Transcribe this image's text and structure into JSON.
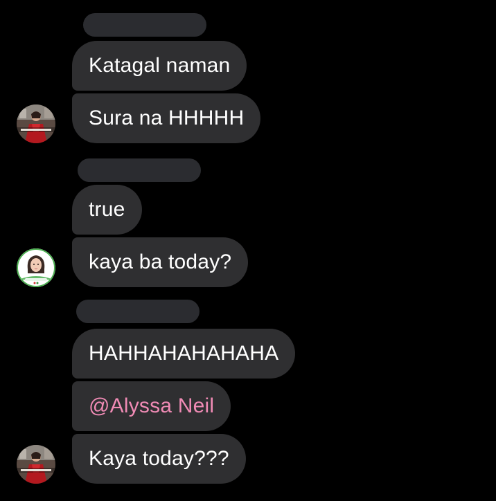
{
  "groups": [
    {
      "messages": [
        "Katagal naman",
        "Sura na HHHHH"
      ],
      "avatar_name": "user-avatar-red-dress"
    },
    {
      "messages": [
        "true",
        "kaya ba today?"
      ],
      "avatar_name": "user-avatar-girl-green-frame"
    },
    {
      "messages": [
        "HAHHAHAHAHAHA",
        "@Alyssa Neil",
        "Kaya today???"
      ],
      "avatar_name": "user-avatar-red-dress"
    }
  ],
  "colors": {
    "background": "#000000",
    "bubble": "#2f2f31",
    "mention": "#f08bb5",
    "redacted": "#2b2c30"
  }
}
